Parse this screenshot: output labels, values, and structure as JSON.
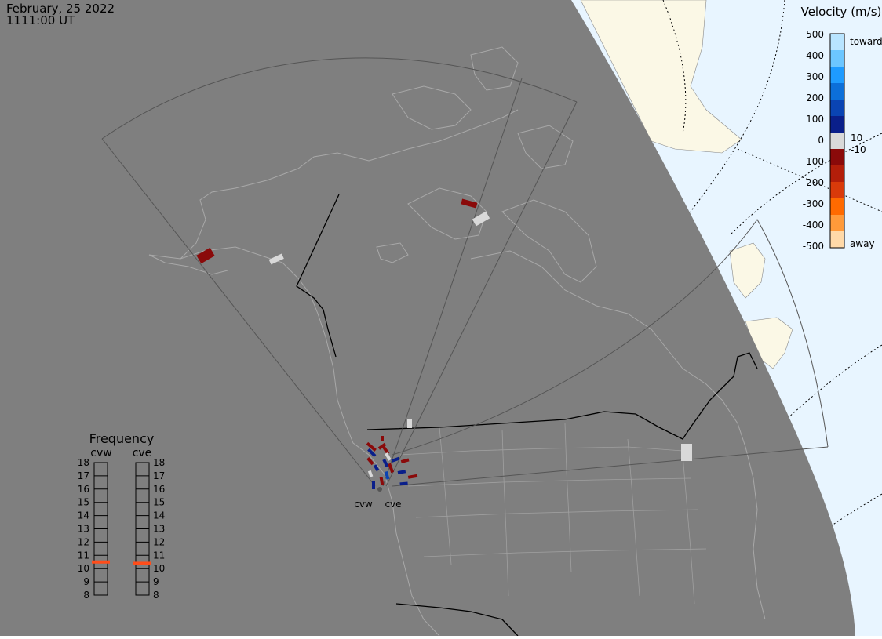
{
  "header": {
    "date": "February, 25 2022",
    "time": "1111:00 UT"
  },
  "velocity_scale": {
    "title": "Velocity (m/s)",
    "ticks": [
      "500",
      "400",
      "300",
      "200",
      "100",
      "10",
      "0",
      "-10",
      "-100",
      "-200",
      "-300",
      "-400",
      "-500"
    ],
    "toward_label": "toward",
    "away_label": "away",
    "colors": [
      "#b8e4ff",
      "#6cc6ff",
      "#1e9bff",
      "#0c6fd9",
      "#0a44b3",
      "#0a1f8a",
      "#d9d9d9",
      "#8a0a0a",
      "#b31e0a",
      "#d93a0a",
      "#ff6a00",
      "#ff9a3a",
      "#ffd9a8"
    ]
  },
  "frequency_panel": {
    "title": "Frequency",
    "radars": [
      {
        "name": "cvw",
        "value": 10.5
      },
      {
        "name": "cve",
        "value": 10.4
      }
    ],
    "ticks": [
      "18",
      "17",
      "16",
      "15",
      "14",
      "13",
      "12",
      "11",
      "10",
      "9",
      "8"
    ],
    "range": [
      8,
      18
    ],
    "marker_color": "#ff4d1a"
  },
  "map": {
    "night_color": "#7f7f7f",
    "ocean_color": "#e8f5ff",
    "land_color": "#fbf8e6",
    "border_color": "#a8a8a8",
    "radar_labels": [
      "cvw",
      "cve"
    ]
  }
}
